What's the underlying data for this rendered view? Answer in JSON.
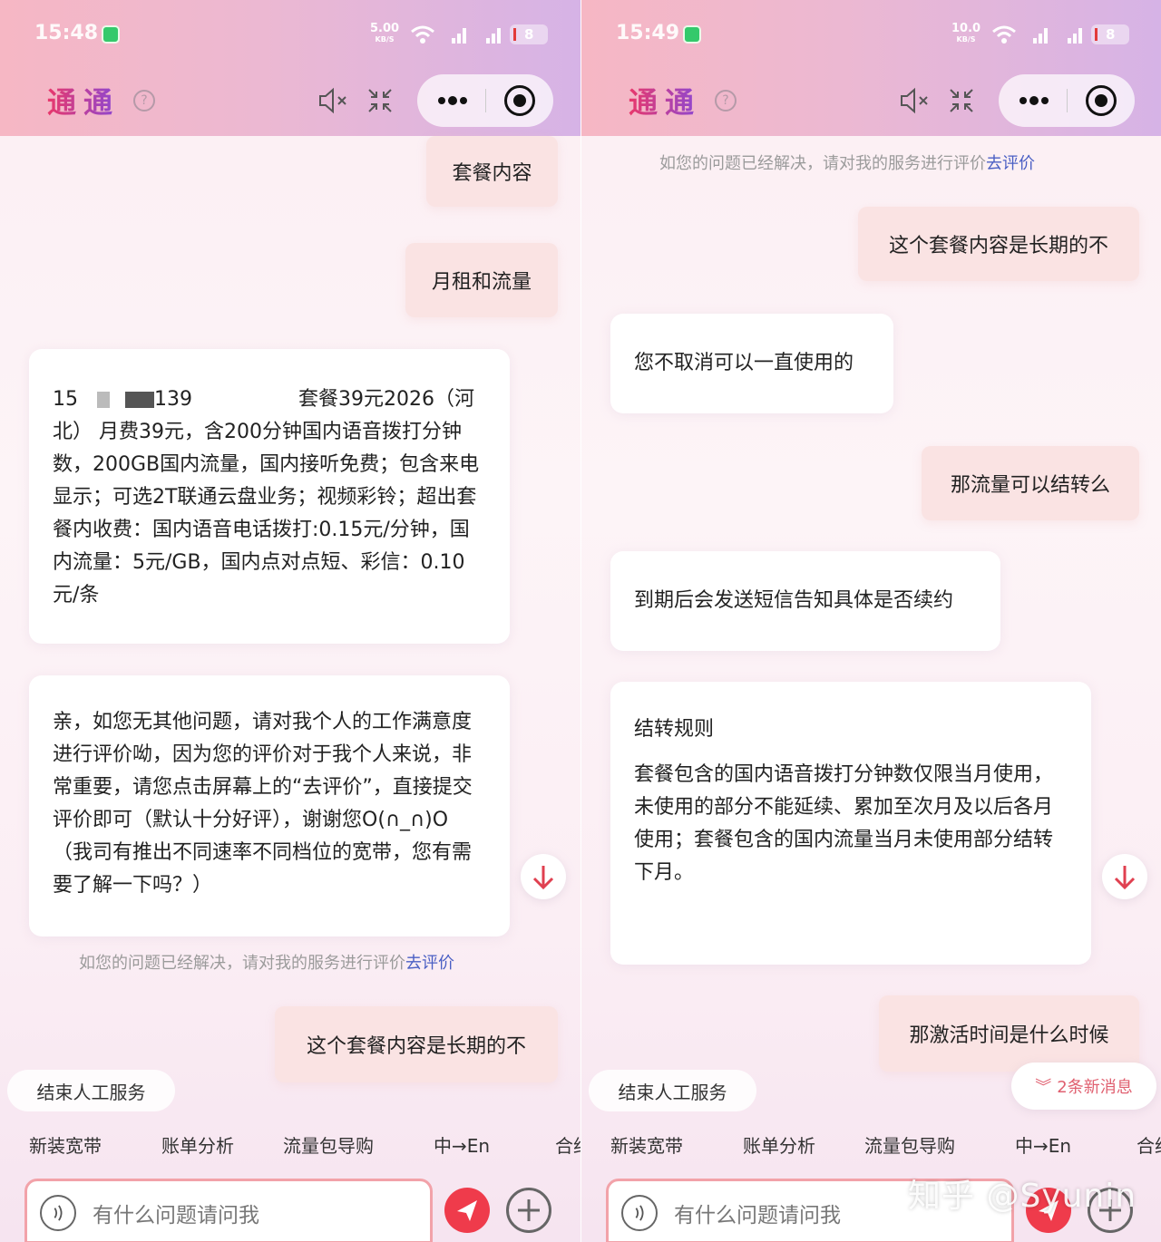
{
  "colors": {
    "accent_red": "#ef3b4b",
    "link_blue": "#4a5fc4",
    "user_bubble": "#fae3e3",
    "input_border": "#f2a2a9"
  },
  "app": {
    "title": "通通"
  },
  "left": {
    "status": {
      "time": "15:48",
      "speed": "5.00",
      "speed_unit": "KB/S",
      "battery": "8"
    },
    "user_bubble_1": "套餐内容",
    "user_bubble_2": "月租和流量",
    "plan_prefix": "15",
    "plan_suffix": "139",
    "plan_name": "套餐39元2026（河",
    "plan_body": "北） 月费39元，含200分钟国内语音拨打分钟数，200GB国内流量，国内接听免费；包含来电显示；可选2T联通云盘业务；视频彩铃；超出套餐内收费：国内语音电话拨打:0.15元/分钟，国内流量：5元/GB，国内点对点短、彩信：0.10元/条",
    "bot_survey": "亲，如您无其他问题，请对我个人的工作满意度进行评价呦，因为您的评价对于我个人来说，非常重要，请您点击屏幕上的“去评价”，直接提交评价即可（默认十分好评），谢谢您O(∩_∩)O（我司有推出不同速率不同档位的宽带，您有需要了解一下吗？）",
    "hint": "如您的问题已经解决，请对我的服务进行评价",
    "hint_link": "去评价",
    "user_bubble_3": "这个套餐内容是长期的不"
  },
  "right": {
    "status": {
      "time": "15:49",
      "speed": "10.0",
      "speed_unit": "KB/S",
      "battery": "8"
    },
    "hint": "如您的问题已经解决，请对我的服务进行评价",
    "hint_link": "去评价",
    "user_bubble_1": "这个套餐内容是长期的不",
    "bot_1": "您不取消可以一直使用的",
    "user_bubble_2": "那流量可以结转么",
    "bot_2": "到期后会发送短信告知具体是否续约",
    "rule_title": "结转规则",
    "rule_body": "套餐包含的国内语音拨打分钟数仅限当月使用，未使用的部分不能延续、累加至次月及以后各月使用；套餐包含的国内流量当月未使用部分结转下月。",
    "user_bubble_3": "那激活时间是什么时候",
    "new_messages": "2条新消息",
    "watermark": "知乎 @Syunin"
  },
  "bottom": {
    "end_service": "结束人工服务",
    "chips": [
      "新装宽带",
      "账单分析",
      "流量包导购",
      "中→En",
      "合约"
    ],
    "input_placeholder": "有什么问题请问我"
  }
}
